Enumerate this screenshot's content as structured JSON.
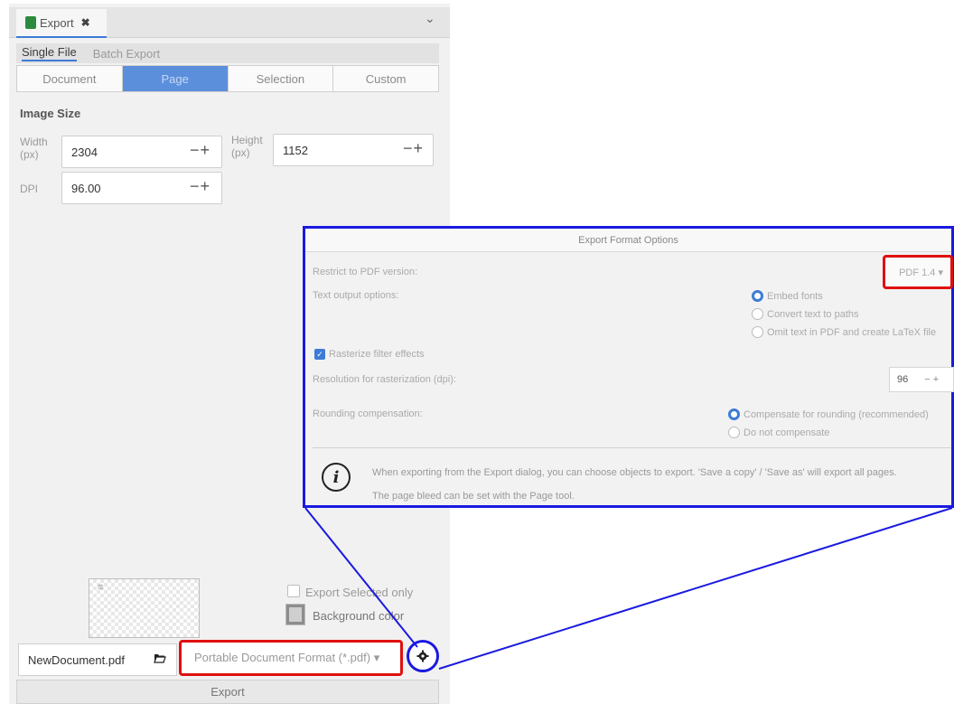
{
  "dialog": {
    "tab_label": "Export",
    "subtabs": [
      "Single File",
      "Batch Export"
    ],
    "segments": [
      {
        "label": "Document",
        "active": false
      },
      {
        "label": "Page",
        "active": true
      },
      {
        "label": "Selection",
        "active": false
      },
      {
        "label": "Custom",
        "active": false
      }
    ],
    "image_size_title": "Image Size",
    "width_label": "Width",
    "width_unit": "(px)",
    "width_value": "2304",
    "height_label": "Height",
    "height_unit": "(px)",
    "height_value": "1152",
    "dpi_label": "DPI",
    "dpi_value": "96.00",
    "stepper_glyph": "−+",
    "export_selected_label": "Export Selected only",
    "background_color_label": "Background color",
    "filename": "NewDocument.pdf",
    "format": "Portable Document Format (*.pdf) ▾",
    "export_button": "Export"
  },
  "popup": {
    "title": "Export Format Options",
    "pdf_version_label": "Restrict to PDF version:",
    "pdf_version_value": "PDF 1.4 ▾",
    "text_output_label": "Text output options:",
    "text_options": [
      "Embed fonts",
      "Convert text to paths",
      "Omit text in PDF and create LaTeX file"
    ],
    "rasterize_label": "Rasterize filter effects",
    "resolution_label": "Resolution for rasterization (dpi):",
    "resolution_value": "96",
    "resolution_stepper": "− +",
    "rounding_label": "Rounding compensation:",
    "rounding_options": [
      "Compensate for rounding (recommended)",
      "Do not compensate"
    ],
    "info_line1": "When exporting from the Export dialog, you can choose objects to export. 'Save a copy' / 'Save as' will export all pages.",
    "info_line2": "The page bleed can be set with the Page tool.",
    "info_glyph": "i"
  },
  "colors": {
    "highlight_red": "#e01010",
    "highlight_blue": "#1a1ae0",
    "accent": "#3d7bd6"
  }
}
